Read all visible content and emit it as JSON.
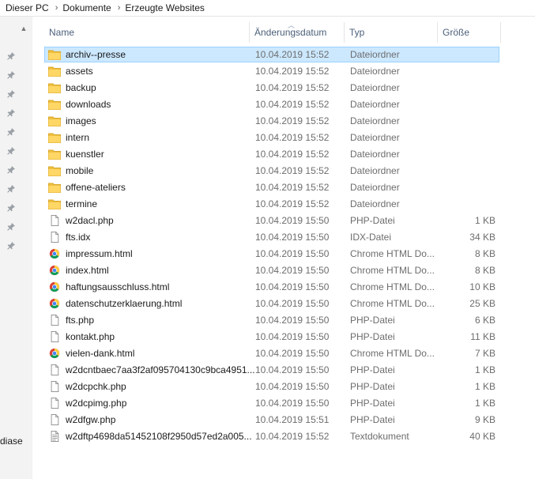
{
  "breadcrumb": {
    "items": [
      "Dieser PC",
      "Dokumente",
      "Erzeugte Websites"
    ],
    "separator": "›"
  },
  "left_pane": {
    "label": "diase",
    "pin_count": 11
  },
  "columns": {
    "name": "Name",
    "date": "Änderungsdatum",
    "type": "Typ",
    "size": "Größe"
  },
  "colors": {
    "selection_bg": "#cce8ff",
    "selection_border": "#99d1ff",
    "folder": "#f0c040",
    "header_text": "#4c607a"
  },
  "files": [
    {
      "name": "archiv--presse",
      "date": "10.04.2019 15:52",
      "type": "Dateiordner",
      "size": "",
      "icon": "folder-icon",
      "selected": true
    },
    {
      "name": "assets",
      "date": "10.04.2019 15:52",
      "type": "Dateiordner",
      "size": "",
      "icon": "folder-icon"
    },
    {
      "name": "backup",
      "date": "10.04.2019 15:52",
      "type": "Dateiordner",
      "size": "",
      "icon": "folder-icon"
    },
    {
      "name": "downloads",
      "date": "10.04.2019 15:52",
      "type": "Dateiordner",
      "size": "",
      "icon": "folder-icon"
    },
    {
      "name": "images",
      "date": "10.04.2019 15:52",
      "type": "Dateiordner",
      "size": "",
      "icon": "folder-icon"
    },
    {
      "name": "intern",
      "date": "10.04.2019 15:52",
      "type": "Dateiordner",
      "size": "",
      "icon": "folder-icon"
    },
    {
      "name": "kuenstler",
      "date": "10.04.2019 15:52",
      "type": "Dateiordner",
      "size": "",
      "icon": "folder-icon"
    },
    {
      "name": "mobile",
      "date": "10.04.2019 15:52",
      "type": "Dateiordner",
      "size": "",
      "icon": "folder-icon"
    },
    {
      "name": "offene-ateliers",
      "date": "10.04.2019 15:52",
      "type": "Dateiordner",
      "size": "",
      "icon": "folder-icon"
    },
    {
      "name": "termine",
      "date": "10.04.2019 15:52",
      "type": "Dateiordner",
      "size": "",
      "icon": "folder-icon"
    },
    {
      "name": "w2dacl.php",
      "date": "10.04.2019 15:50",
      "type": "PHP-Datei",
      "size": "1 KB",
      "icon": "file-icon"
    },
    {
      "name": "fts.idx",
      "date": "10.04.2019 15:50",
      "type": "IDX-Datei",
      "size": "34 KB",
      "icon": "file-icon"
    },
    {
      "name": "impressum.html",
      "date": "10.04.2019 15:50",
      "type": "Chrome HTML Do...",
      "size": "8 KB",
      "icon": "chrome-icon"
    },
    {
      "name": "index.html",
      "date": "10.04.2019 15:50",
      "type": "Chrome HTML Do...",
      "size": "8 KB",
      "icon": "chrome-icon"
    },
    {
      "name": "haftungsausschluss.html",
      "date": "10.04.2019 15:50",
      "type": "Chrome HTML Do...",
      "size": "10 KB",
      "icon": "chrome-icon"
    },
    {
      "name": "datenschutzerklaerung.html",
      "date": "10.04.2019 15:50",
      "type": "Chrome HTML Do...",
      "size": "25 KB",
      "icon": "chrome-icon"
    },
    {
      "name": "fts.php",
      "date": "10.04.2019 15:50",
      "type": "PHP-Datei",
      "size": "6 KB",
      "icon": "file-icon"
    },
    {
      "name": "kontakt.php",
      "date": "10.04.2019 15:50",
      "type": "PHP-Datei",
      "size": "11 KB",
      "icon": "file-icon"
    },
    {
      "name": "vielen-dank.html",
      "date": "10.04.2019 15:50",
      "type": "Chrome HTML Do...",
      "size": "7 KB",
      "icon": "chrome-icon"
    },
    {
      "name": "w2dcntbaec7aa3f2af095704130c9bca4951...",
      "date": "10.04.2019 15:50",
      "type": "PHP-Datei",
      "size": "1 KB",
      "icon": "file-icon"
    },
    {
      "name": "w2dcpchk.php",
      "date": "10.04.2019 15:50",
      "type": "PHP-Datei",
      "size": "1 KB",
      "icon": "file-icon"
    },
    {
      "name": "w2dcpimg.php",
      "date": "10.04.2019 15:50",
      "type": "PHP-Datei",
      "size": "1 KB",
      "icon": "file-icon"
    },
    {
      "name": "w2dfgw.php",
      "date": "10.04.2019 15:51",
      "type": "PHP-Datei",
      "size": "9 KB",
      "icon": "file-icon"
    },
    {
      "name": "w2dftp4698da51452108f2950d57ed2a005...",
      "date": "10.04.2019 15:52",
      "type": "Textdokument",
      "size": "40 KB",
      "icon": "text-file-icon"
    }
  ]
}
